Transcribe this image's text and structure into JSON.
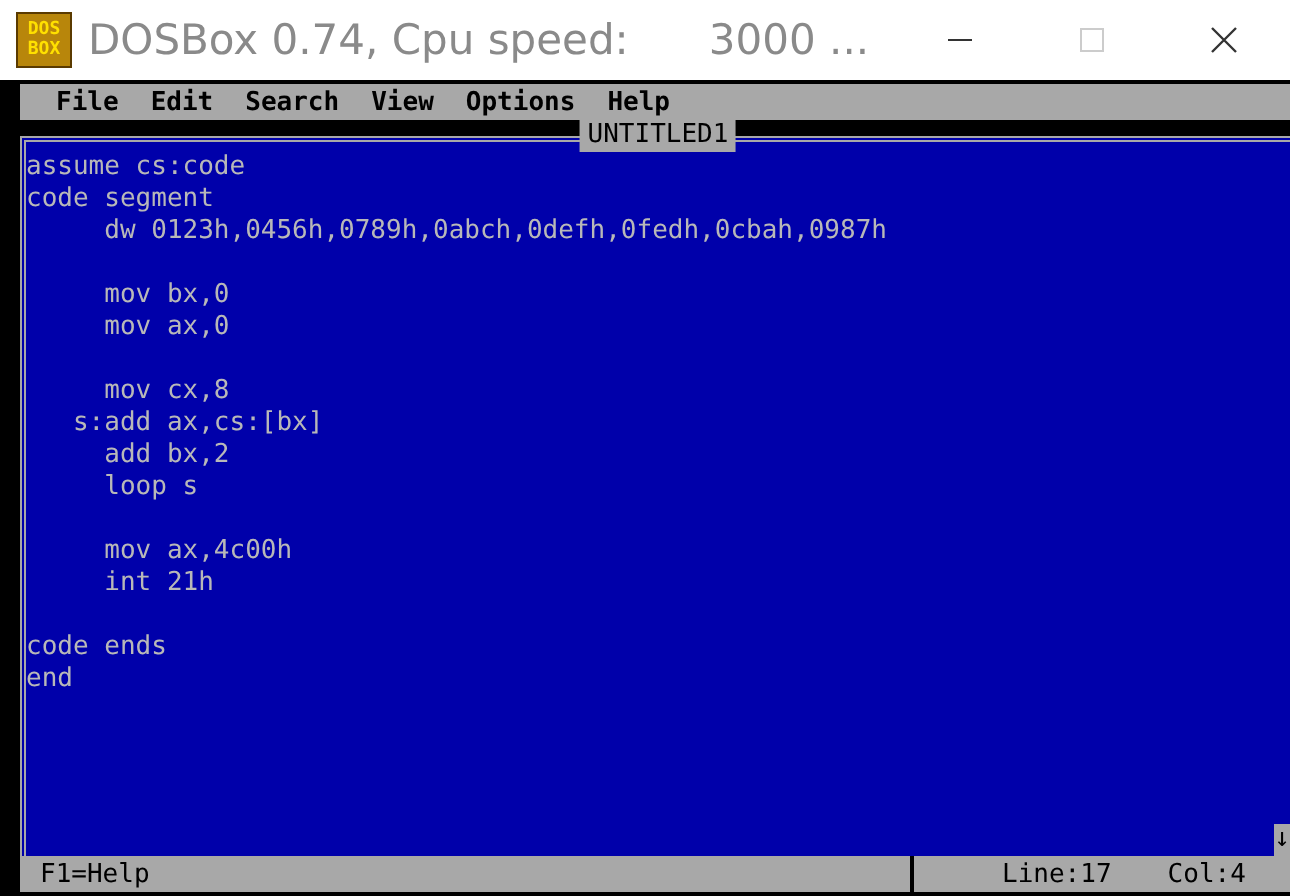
{
  "window": {
    "logo": [
      "DOS",
      "BOX"
    ],
    "title": "DOSBox 0.74, Cpu speed:      3000 ...",
    "controls": [
      {
        "kind": "minimize",
        "disabled": false
      },
      {
        "kind": "maximize",
        "disabled": true
      },
      {
        "kind": "close",
        "disabled": false
      }
    ]
  },
  "menu": [
    "File",
    "Edit",
    "Search",
    "View",
    "Options",
    "Help"
  ],
  "editor": {
    "title": "UNTITLED1",
    "scroll_arrow": "↓",
    "blocks": [
      [
        "assume cs:code",
        "code segment",
        "     dw 0123h,0456h,0789h,0abch,0defh,0fedh,0cbah,0987h"
      ],
      [
        "     mov bx,0",
        "     mov ax,0"
      ],
      [
        "     mov cx,8",
        "   s:add ax,cs:[bx]",
        "     add bx,2",
        "     loop s"
      ],
      [
        "     mov ax,4c00h",
        "     int 21h"
      ],
      [
        "code ends",
        "end"
      ]
    ]
  },
  "status_bar": {
    "help": "F1=Help",
    "line": "Line:17",
    "col": "Col:4"
  }
}
